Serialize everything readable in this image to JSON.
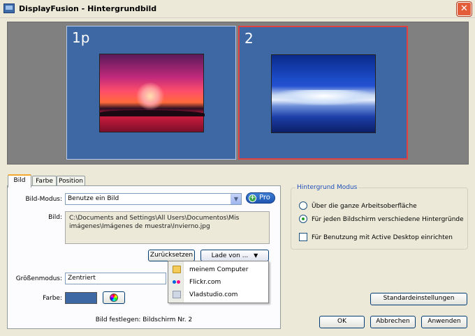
{
  "window": {
    "title": "DisplayFusion - Hintergrundbild",
    "close_glyph": "✕"
  },
  "preview": {
    "monitors": [
      {
        "label": "1p",
        "selected": false
      },
      {
        "label": "2",
        "selected": true
      }
    ]
  },
  "tabs": [
    {
      "label": "Bild",
      "active": true
    },
    {
      "label": "Farbe",
      "active": false
    },
    {
      "label": "Position",
      "active": false
    }
  ],
  "bild": {
    "mode_label": "Bild-Modus:",
    "mode_value": "Benutze ein Bild",
    "pro_label": "Pro",
    "image_label": "Bild:",
    "image_path": "C:\\Documents and Settings\\All Users\\Documentos\\Mis imágenes\\Imágenes de muestra\\Invierno.jpg",
    "reset_label": "Zurücksetzen",
    "load_label": "Lade von ...",
    "load_menu": [
      "meinem Computer",
      "Flickr.com",
      "Vladstudio.com"
    ],
    "size_mode_label": "Größenmodus:",
    "size_mode_value": "Zentriert",
    "color_label": "Farbe:",
    "color_value": "#3e68a3",
    "status_text": "Bild festlegen: Bildschirm Nr. 2"
  },
  "mode_group": {
    "title": "Hintergrund Modus",
    "options": [
      {
        "label": "Über die ganze Arbeitsoberfläche",
        "checked": false
      },
      {
        "label": "Für jeden Bildschirm verschiedene Hintergründe",
        "checked": true
      }
    ],
    "checkbox_label": "Für Benutzung mit Active Desktop einrichten",
    "checkbox_checked": false
  },
  "buttons": {
    "defaults": "Standardeinstellungen",
    "ok": "OK",
    "cancel": "Abbrechen",
    "apply": "Anwenden"
  },
  "colors": {
    "monitor_bg": "#3e68a3",
    "selected_border": "#e04040",
    "group_title": "#1f4fb8"
  }
}
